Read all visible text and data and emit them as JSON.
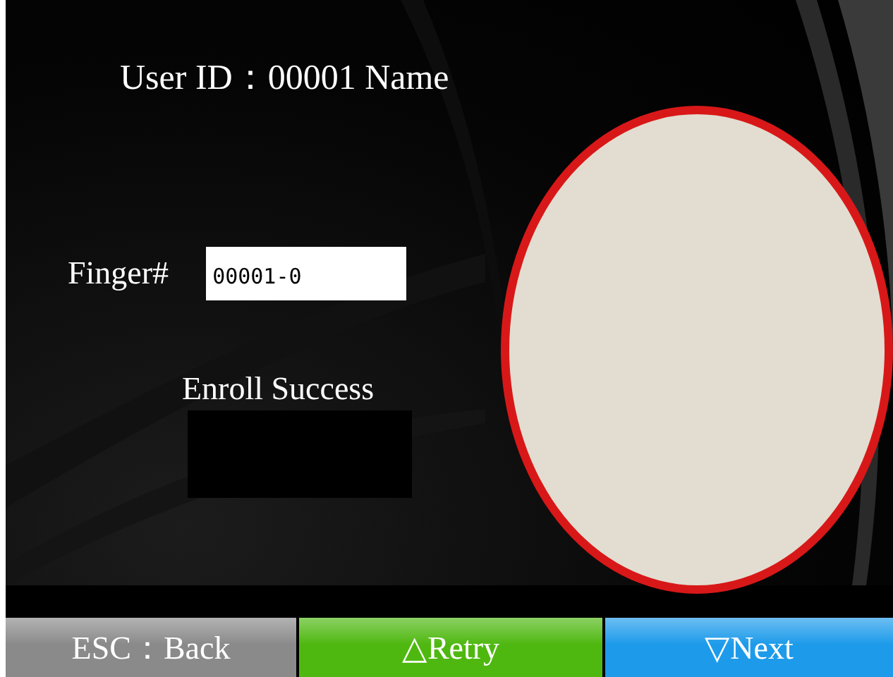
{
  "user_line": "User ID：00001 Name",
  "finger": {
    "label": "Finger#",
    "value": "00001-0"
  },
  "status": "Enroll Success",
  "buttons": [
    {
      "label": "ESC：Back",
      "color": "#8a8a8a"
    },
    {
      "label": "△Retry",
      "color": "#4fb810"
    },
    {
      "label": "▽Next",
      "color": "#1d9bea"
    }
  ]
}
